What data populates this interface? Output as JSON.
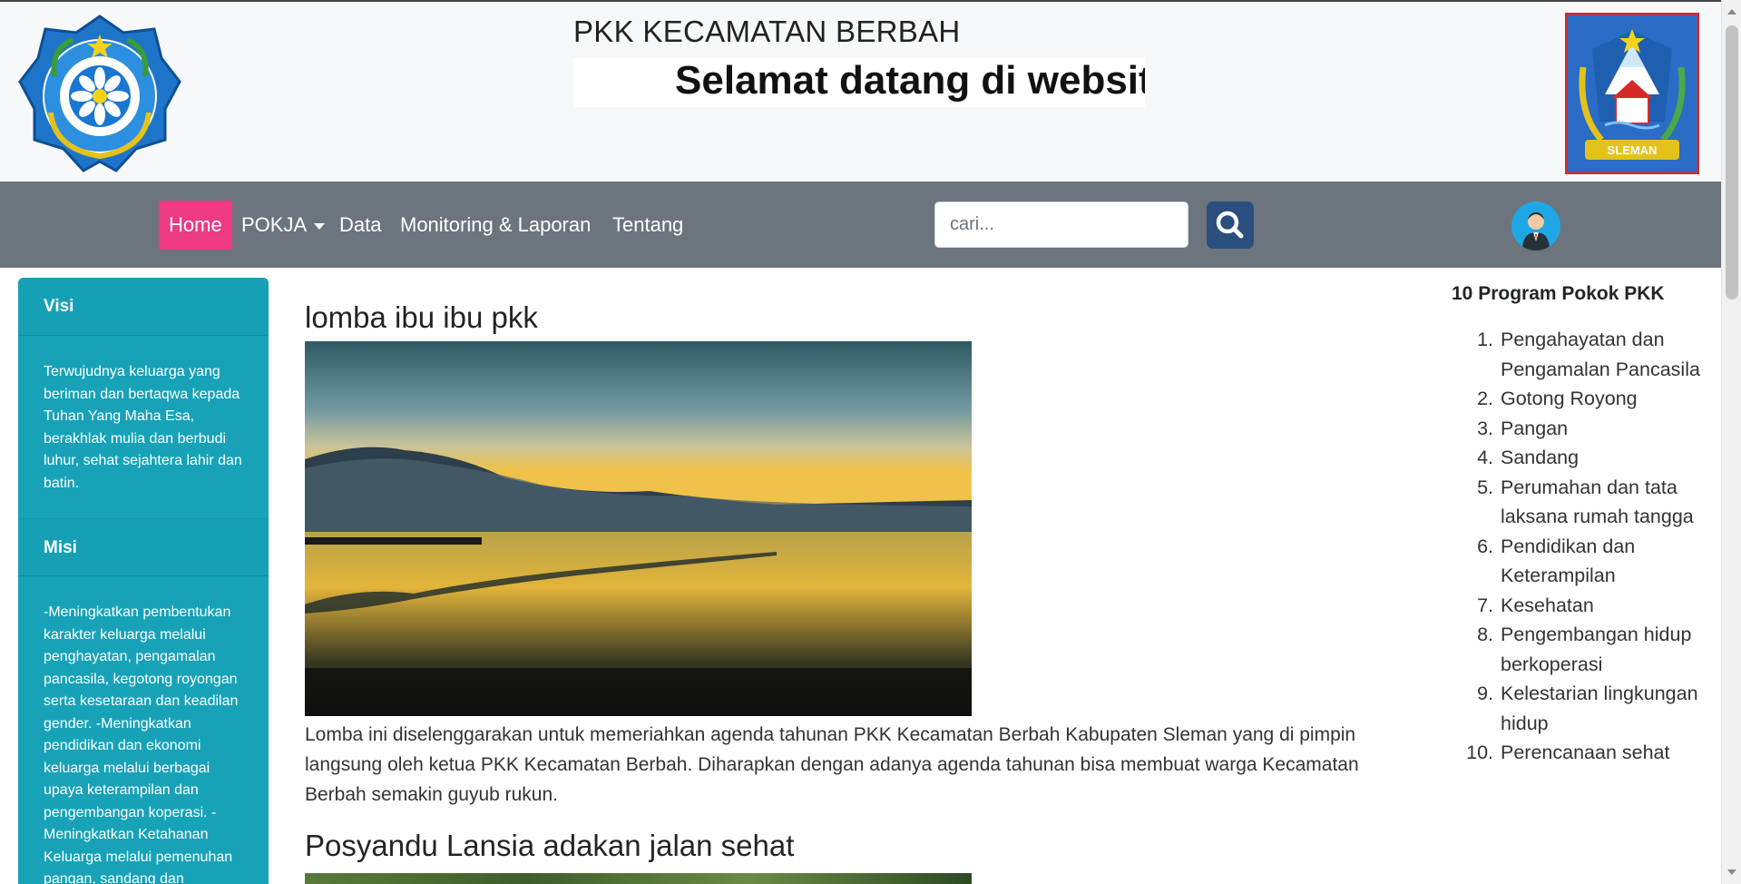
{
  "header": {
    "title": "PKK KECAMATAN BERBAH",
    "marquee": "Selamat datang di website"
  },
  "navbar": {
    "items": [
      {
        "label": "Home",
        "active": true
      },
      {
        "label": "POKJA",
        "dropdown": true
      },
      {
        "label": "Data"
      },
      {
        "label": "Monitoring & Laporan"
      },
      {
        "label": "Tentang"
      }
    ],
    "search_placeholder": "cari...",
    "accent_color": "#ee3a82",
    "bar_color": "#6c757d"
  },
  "sidebar": {
    "visi_heading": "Visi",
    "visi_text": "Terwujudnya keluarga yang beriman dan bertaqwa kepada Tuhan Yang Maha Esa, berakhlak mulia dan berbudi luhur, sehat sejahtera lahir dan batin.",
    "misi_heading": "Misi",
    "misi_text": "-Meningkatkan pembentukan karakter keluarga melalui penghayatan, pengamalan pancasila, kegotong royongan serta kesetaraan dan keadilan gender. -Meningkatkan pendidikan dan ekonomi keluarga melalui berbagai upaya keterampilan dan pengembangan koperasi. -Meningkatkan Ketahanan Keluarga melalui pemenuhan pangan, sandang dan",
    "color": "#17a2b8"
  },
  "posts": [
    {
      "title": "lomba ibu ibu pkk",
      "text": "Lomba ini diselenggarakan untuk memeriahkan agenda tahunan PKK Kecamatan Berbah Kabupaten Sleman yang di pimpin langsung oleh ketua PKK Kecamatan Berbah. Diharapkan dengan adanya agenda tahunan bisa membuat warga Kecamatan Berbah semakin guyub rukun."
    },
    {
      "title": "Posyandu Lansia adakan jalan sehat"
    }
  ],
  "program": {
    "title": "10 Program Pokok PKK",
    "items": [
      {
        "num": "1.",
        "text": "Pengahayatan dan Pengamalan Pancasila"
      },
      {
        "num": "2.",
        "text": "Gotong Royong"
      },
      {
        "num": "3.",
        "text": "Pangan"
      },
      {
        "num": "4.",
        "text": "Sandang"
      },
      {
        "num": "5.",
        "text": "Perumahan dan tata laksana rumah tangga"
      },
      {
        "num": "6.",
        "text": "Pendidikan dan Keterampilan"
      },
      {
        "num": "7.",
        "text": "Kesehatan"
      },
      {
        "num": "8.",
        "text": "Pengembangan hidup berkoperasi"
      },
      {
        "num": "9.",
        "text": "Kelestarian lingkungan hidup"
      },
      {
        "num": "10.",
        "text": "Perencanaan sehat"
      }
    ]
  },
  "icons": {
    "left_logo": "pkk-logo-icon",
    "right_logo": "sleman-logo-icon",
    "search": "search-icon",
    "user": "user-avatar-icon"
  }
}
